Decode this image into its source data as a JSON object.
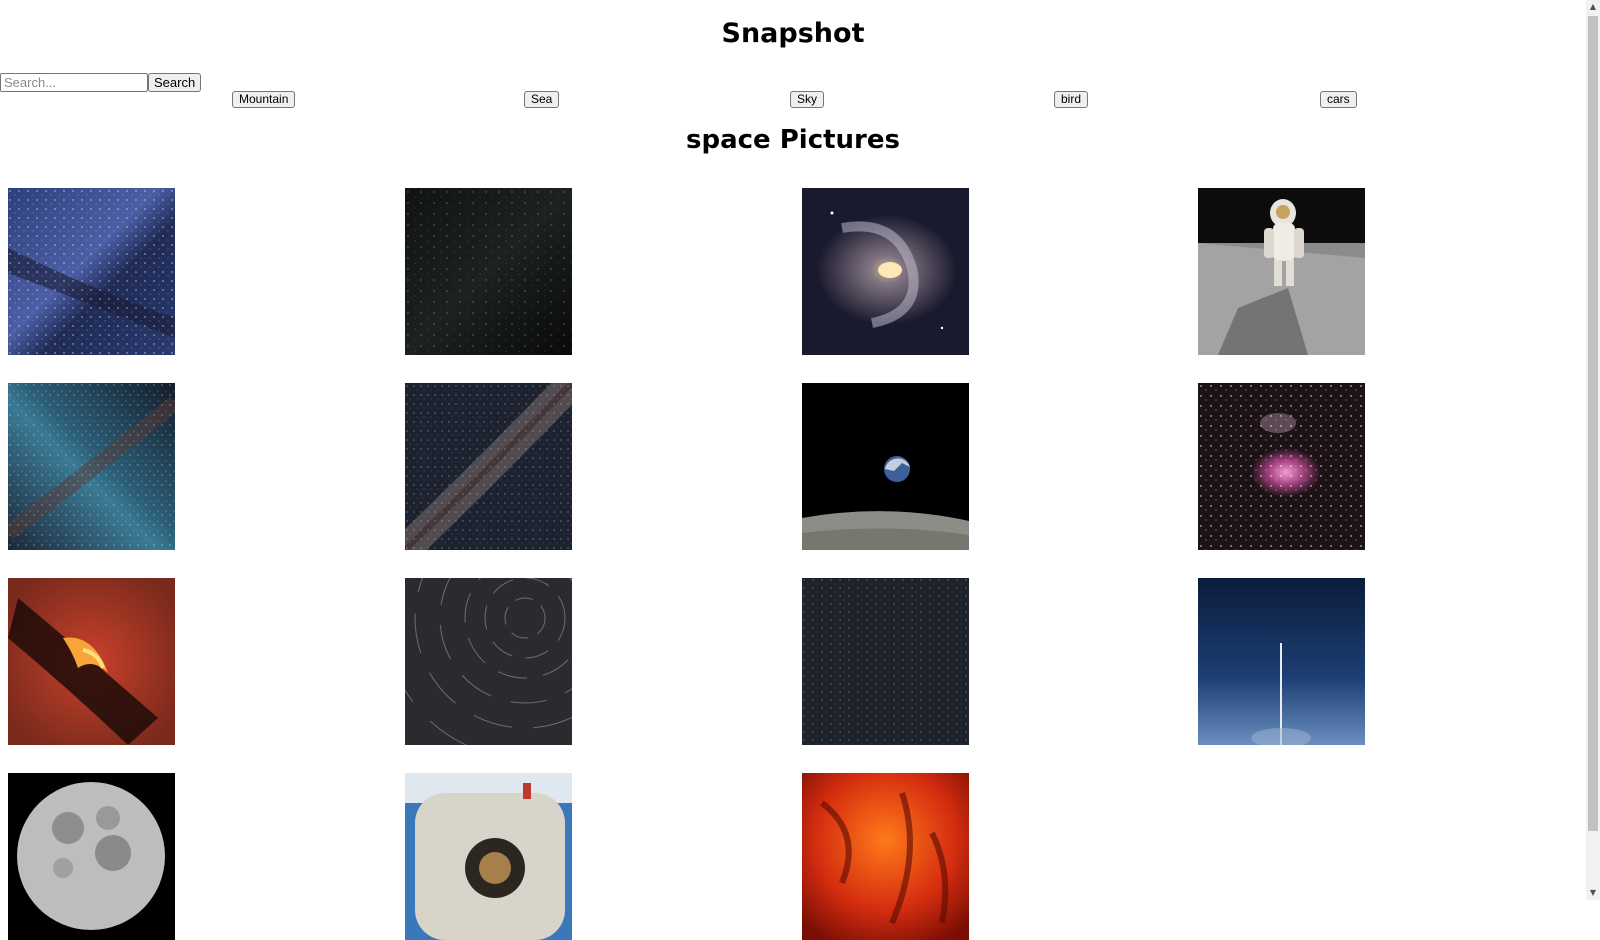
{
  "app": {
    "title": "Snapshot"
  },
  "search": {
    "placeholder": "Search...",
    "button_label": "Search"
  },
  "categories": [
    {
      "label": "Mountain"
    },
    {
      "label": "Sea"
    },
    {
      "label": "Sky"
    },
    {
      "label": "bird"
    },
    {
      "label": "cars"
    }
  ],
  "gallery": {
    "heading": "space Pictures",
    "images": [
      {
        "subject": "milky-way-blue-starfield"
      },
      {
        "subject": "dark-starfield"
      },
      {
        "subject": "barred-spiral-galaxy"
      },
      {
        "subject": "astronaut-on-moon"
      },
      {
        "subject": "teal-milky-way"
      },
      {
        "subject": "milky-way-band"
      },
      {
        "subject": "earthrise-over-moon"
      },
      {
        "subject": "orion-nebula"
      },
      {
        "subject": "fiery-nebula"
      },
      {
        "subject": "star-trails"
      },
      {
        "subject": "night-starfield"
      },
      {
        "subject": "rocket-launch-trail"
      },
      {
        "subject": "full-moon"
      },
      {
        "subject": "astronaut-spacewalk"
      },
      {
        "subject": "red-nebula"
      }
    ]
  },
  "scrollbar": {
    "up_glyph": "▲",
    "down_glyph": "▼"
  }
}
